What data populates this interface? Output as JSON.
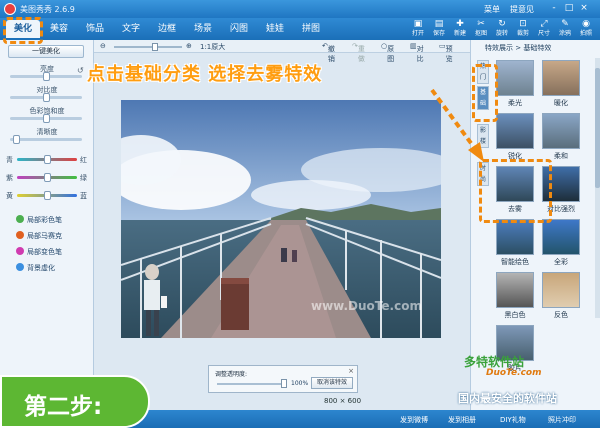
{
  "titlebar": {
    "app_title": "美图秀秀 2.6.9",
    "menu_items": [
      "菜单",
      "提意见"
    ],
    "window_controls": [
      "-",
      "□",
      "×"
    ]
  },
  "tabs": [
    {
      "label": "美化",
      "active": true
    },
    {
      "label": "美容",
      "active": false
    },
    {
      "label": "饰品",
      "active": false
    },
    {
      "label": "文字",
      "active": false
    },
    {
      "label": "边框",
      "active": false
    },
    {
      "label": "场景",
      "active": false
    },
    {
      "label": "闪图",
      "active": false
    },
    {
      "label": "娃娃",
      "active": false
    },
    {
      "label": "拼图",
      "active": false
    }
  ],
  "toolbar": [
    {
      "label": "打开",
      "icon": "folder-icon"
    },
    {
      "label": "保存",
      "icon": "save-icon"
    },
    {
      "label": "新建",
      "icon": "new-icon"
    },
    {
      "label": "抠图",
      "icon": "cutout-icon"
    },
    {
      "label": "旋转",
      "icon": "rotate-icon"
    },
    {
      "label": "裁剪",
      "icon": "crop-icon"
    },
    {
      "label": "尺寸",
      "icon": "resize-icon"
    },
    {
      "label": "涂鸦",
      "icon": "brush-icon"
    },
    {
      "label": "拍照",
      "icon": "camera-icon"
    }
  ],
  "left_panel": {
    "one_key_label": "一键美化",
    "adjustments": [
      {
        "label": "亮度",
        "level": 0.5
      },
      {
        "label": "对比度",
        "level": 0.5
      },
      {
        "label": "色彩饱和度",
        "level": 0.5
      },
      {
        "label": "清晰度",
        "level": 0.05
      }
    ],
    "color_sliders": [
      {
        "left": "青",
        "right": "红",
        "level": 0.5
      },
      {
        "left": "紫",
        "right": "绿",
        "level": 0.5
      },
      {
        "left": "黄",
        "right": "蓝",
        "level": 0.5
      }
    ],
    "pens": [
      {
        "label": "局部彩色笔",
        "color": "#4caf50"
      },
      {
        "label": "局部马赛克",
        "color": "#e06020"
      },
      {
        "label": "局部变色笔",
        "color": "#d03bb0"
      },
      {
        "label": "背景虚化",
        "color": "#3b8fe0"
      }
    ]
  },
  "canvas_toolbar": {
    "zoom_label": "1:1原大",
    "undo": "撤销",
    "redo": "重做",
    "original": "原图",
    "compare": "对比",
    "preview": "预览"
  },
  "transparency": {
    "label": "调整透明度:",
    "value": "100%",
    "level": 1.0,
    "cancel": "取消该特效"
  },
  "image_size": "800 × 600",
  "photo_watermark": "www.DuoTe.com",
  "right_panel": {
    "breadcrumb": "特效展示 > 基础特效",
    "side_tabs": [
      "热门",
      "基础",
      "影楼",
      "时尚"
    ],
    "effects": [
      {
        "label": "柔光"
      },
      {
        "label": "暖化"
      },
      {
        "label": "锐化"
      },
      {
        "label": "柔和"
      },
      {
        "label": "去雾",
        "selected": true
      },
      {
        "label": "对比强烈"
      },
      {
        "label": "智能绘色"
      },
      {
        "label": "全彩"
      },
      {
        "label": "黑白色"
      },
      {
        "label": "反色"
      },
      {
        "label": "胶片"
      }
    ]
  },
  "overlay": {
    "instruction": "点击基础分类 选择去雾特效",
    "step": "第二步:",
    "watermark_logo": "多特软件站",
    "watermark_url": "DuoTe.com",
    "watermark_big": "国内最安全的软件站"
  },
  "statusbar": {
    "items": [
      "发到微博",
      "发到相册",
      "DIY礼物",
      "照片冲印"
    ]
  }
}
